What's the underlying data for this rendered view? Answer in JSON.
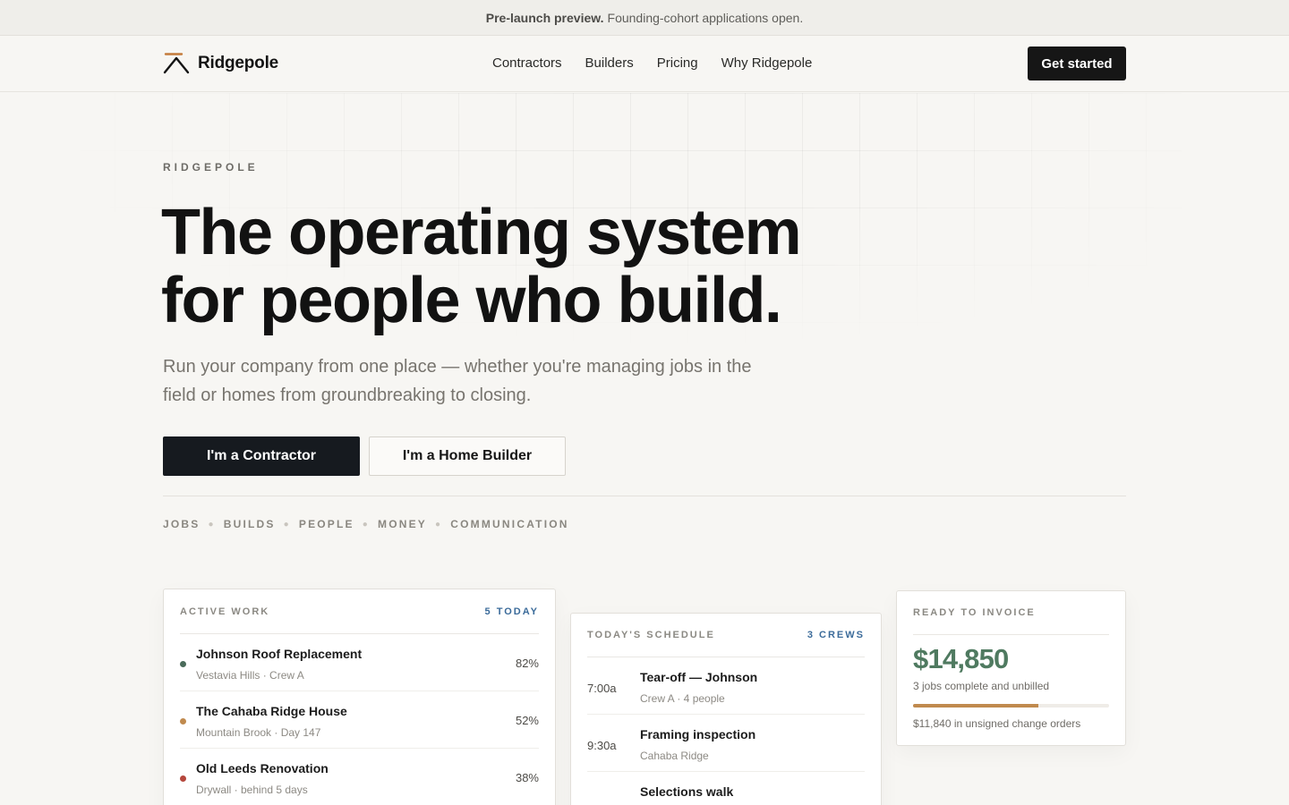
{
  "announcement": {
    "strong": "Pre-launch preview.",
    "text": "Founding-cohort applications open."
  },
  "nav": {
    "brand": "Ridgepole",
    "links": [
      "Contractors",
      "Builders",
      "Pricing",
      "Why Ridgepole"
    ],
    "cta": "Get started"
  },
  "hero": {
    "eyebrow": "RIDGEPOLE",
    "headline_line1": "The operating system",
    "headline_line2": "for people who build.",
    "subhead": "Run your company from one place — whether you're managing jobs in the field or homes from groundbreaking to closing.",
    "primary_cta": "I'm a Contractor",
    "secondary_cta": "I'm a Home Builder",
    "pillars": [
      "JOBS",
      "BUILDS",
      "PEOPLE",
      "MONEY",
      "COMMUNICATION"
    ]
  },
  "active_work": {
    "label": "ACTIVE WORK",
    "count": "5 TODAY",
    "rows": [
      {
        "title": "Johnson Roof Replacement",
        "meta": "Vestavia Hills · Crew A",
        "pct": "82%",
        "color": "#4a6b5a"
      },
      {
        "title": "The Cahaba Ridge House",
        "meta": "Mountain Brook · Day 147",
        "pct": "52%",
        "color": "#c08a4e"
      },
      {
        "title": "Old Leeds Renovation",
        "meta": "Drywall · behind 5 days",
        "pct": "38%",
        "color": "#b5473c"
      }
    ]
  },
  "schedule": {
    "label": "TODAY'S SCHEDULE",
    "count": "3 CREWS",
    "rows": [
      {
        "time": "7:00a",
        "title": "Tear-off — Johnson",
        "meta": "Crew A · 4 people"
      },
      {
        "time": "9:30a",
        "title": "Framing inspection",
        "meta": "Cahaba Ridge"
      },
      {
        "time": "",
        "title": "Selections walk",
        "meta": ""
      }
    ]
  },
  "invoice": {
    "label": "READY TO INVOICE",
    "amount": "$14,850",
    "subtitle": "3 jobs complete and unbilled",
    "progress_fraction": 0.64,
    "note": "$11,840 in unsigned change orders"
  }
}
